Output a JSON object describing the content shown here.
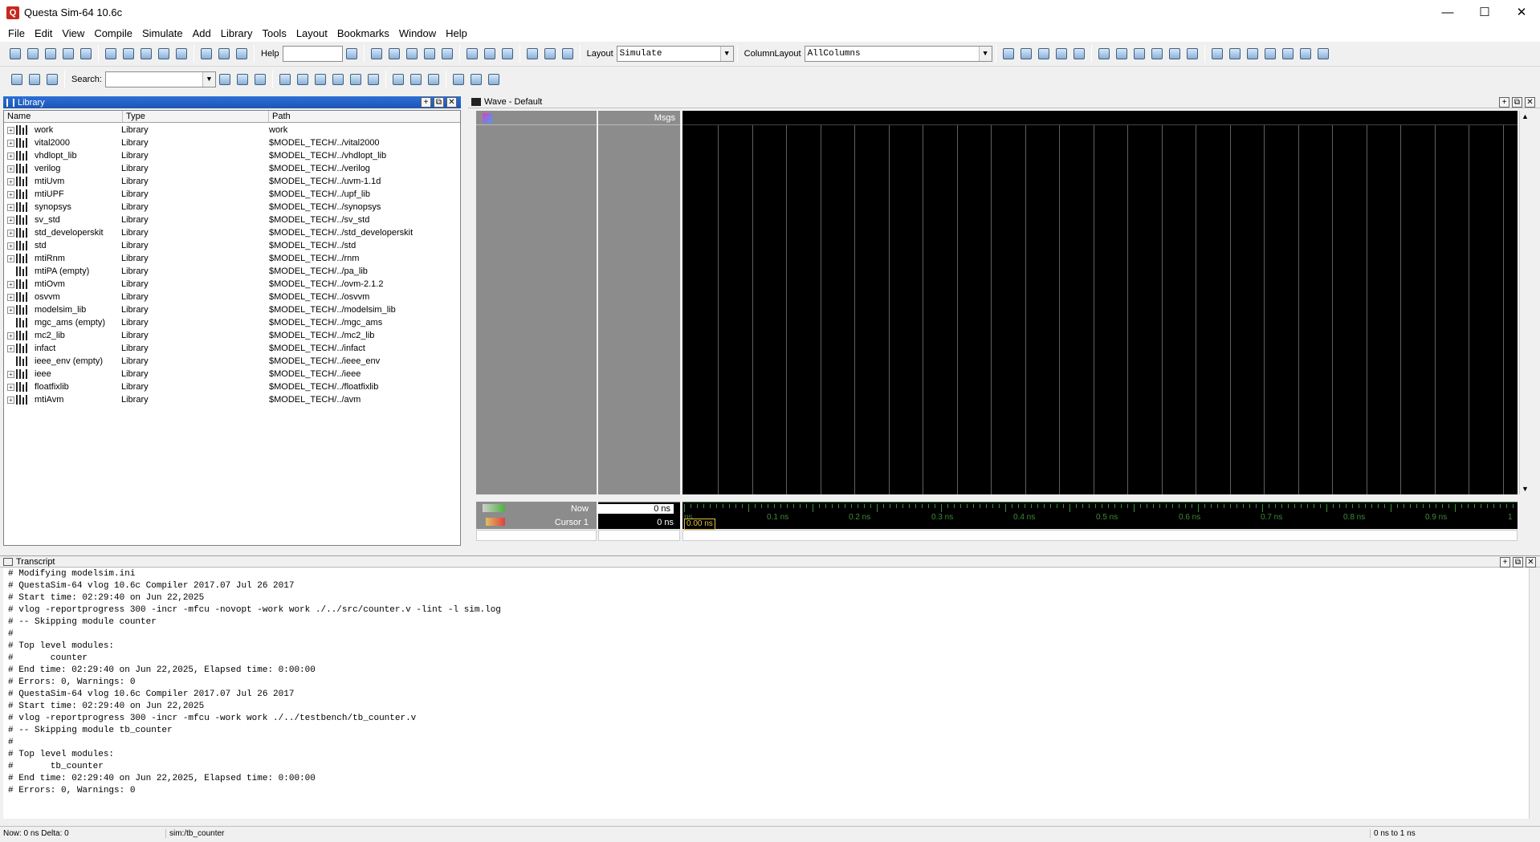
{
  "window": {
    "title": "Questa Sim-64 10.6c",
    "controls": {
      "minimize": "—",
      "maximize": "☐",
      "close": "✕"
    }
  },
  "menubar": [
    "File",
    "Edit",
    "View",
    "Compile",
    "Simulate",
    "Add",
    "Library",
    "Tools",
    "Layout",
    "Bookmarks",
    "Window",
    "Help"
  ],
  "toolbar": {
    "help_label": "Help",
    "layout_label": "Layout",
    "layout_value": "Simulate",
    "column_layout_label": "ColumnLayout",
    "column_layout_value": "AllColumns",
    "search_label": "Search:"
  },
  "library_panel": {
    "title": "Library",
    "columns": [
      "Name",
      "Type",
      "Path"
    ],
    "rows": [
      {
        "name": "work",
        "type": "Library",
        "path": "work",
        "expandable": true
      },
      {
        "name": "vital2000",
        "type": "Library",
        "path": "$MODEL_TECH/../vital2000",
        "expandable": true
      },
      {
        "name": "vhdlopt_lib",
        "type": "Library",
        "path": "$MODEL_TECH/../vhdlopt_lib",
        "expandable": true
      },
      {
        "name": "verilog",
        "type": "Library",
        "path": "$MODEL_TECH/../verilog",
        "expandable": true
      },
      {
        "name": "mtiUvm",
        "type": "Library",
        "path": "$MODEL_TECH/../uvm-1.1d",
        "expandable": true
      },
      {
        "name": "mtiUPF",
        "type": "Library",
        "path": "$MODEL_TECH/../upf_lib",
        "expandable": true
      },
      {
        "name": "synopsys",
        "type": "Library",
        "path": "$MODEL_TECH/../synopsys",
        "expandable": true
      },
      {
        "name": "sv_std",
        "type": "Library",
        "path": "$MODEL_TECH/../sv_std",
        "expandable": true
      },
      {
        "name": "std_developerskit",
        "type": "Library",
        "path": "$MODEL_TECH/../std_developerskit",
        "expandable": true
      },
      {
        "name": "std",
        "type": "Library",
        "path": "$MODEL_TECH/../std",
        "expandable": true
      },
      {
        "name": "mtiRnm",
        "type": "Library",
        "path": "$MODEL_TECH/../rnm",
        "expandable": true
      },
      {
        "name": "mtiPA  (empty)",
        "type": "Library",
        "path": "$MODEL_TECH/../pa_lib",
        "expandable": false
      },
      {
        "name": "mtiOvm",
        "type": "Library",
        "path": "$MODEL_TECH/../ovm-2.1.2",
        "expandable": true
      },
      {
        "name": "osvvm",
        "type": "Library",
        "path": "$MODEL_TECH/../osvvm",
        "expandable": true
      },
      {
        "name": "modelsim_lib",
        "type": "Library",
        "path": "$MODEL_TECH/../modelsim_lib",
        "expandable": true
      },
      {
        "name": "mgc_ams  (empty)",
        "type": "Library",
        "path": "$MODEL_TECH/../mgc_ams",
        "expandable": false
      },
      {
        "name": "mc2_lib",
        "type": "Library",
        "path": "$MODEL_TECH/../mc2_lib",
        "expandable": true
      },
      {
        "name": "infact",
        "type": "Library",
        "path": "$MODEL_TECH/../infact",
        "expandable": true
      },
      {
        "name": "ieee_env  (empty)",
        "type": "Library",
        "path": "$MODEL_TECH/../ieee_env",
        "expandable": false
      },
      {
        "name": "ieee",
        "type": "Library",
        "path": "$MODEL_TECH/../ieee",
        "expandable": true
      },
      {
        "name": "floatfixlib",
        "type": "Library",
        "path": "$MODEL_TECH/../floatfixlib",
        "expandable": true
      },
      {
        "name": "mtiAvm",
        "type": "Library",
        "path": "$MODEL_TECH/../avm",
        "expandable": true
      }
    ]
  },
  "wave_panel": {
    "title": "Wave - Default",
    "msgs_header": "Msgs",
    "now_label": "Now",
    "now_value": "0 ns",
    "cursor_label": "Cursor 1",
    "cursor_value": "0 ns",
    "cursor_marker": "0.00 ns",
    "ticks": [
      "ns",
      "0.1 ns",
      "0.2 ns",
      "0.3 ns",
      "0.4 ns",
      "0.5 ns",
      "0.6 ns",
      "0.7 ns",
      "0.8 ns",
      "0.9 ns",
      "1"
    ]
  },
  "transcript": {
    "title": "Transcript",
    "lines": [
      "# Modifying modelsim.ini",
      "# QuestaSim-64 vlog 10.6c Compiler 2017.07 Jul 26 2017",
      "# Start time: 02:29:40 on Jun 22,2025",
      "# vlog -reportprogress 300 -incr -mfcu -novopt -work work ./../src/counter.v -lint -l sim.log",
      "# -- Skipping module counter",
      "#",
      "# Top level modules:",
      "#       counter",
      "# End time: 02:29:40 on Jun 22,2025, Elapsed time: 0:00:00",
      "# Errors: 0, Warnings: 0",
      "# QuestaSim-64 vlog 10.6c Compiler 2017.07 Jul 26 2017",
      "# Start time: 02:29:40 on Jun 22,2025",
      "# vlog -reportprogress 300 -incr -mfcu -work work ./../testbench/tb_counter.v",
      "# -- Skipping module tb_counter",
      "#",
      "# Top level modules:",
      "#       tb_counter",
      "# End time: 02:29:40 on Jun 22,2025, Elapsed time: 0:00:00",
      "# Errors: 0, Warnings: 0"
    ]
  },
  "statusbar": {
    "left": "Now: 0 ns  Delta: 0",
    "middle": "sim:/tb_counter",
    "right": "0 ns to 1 ns"
  }
}
